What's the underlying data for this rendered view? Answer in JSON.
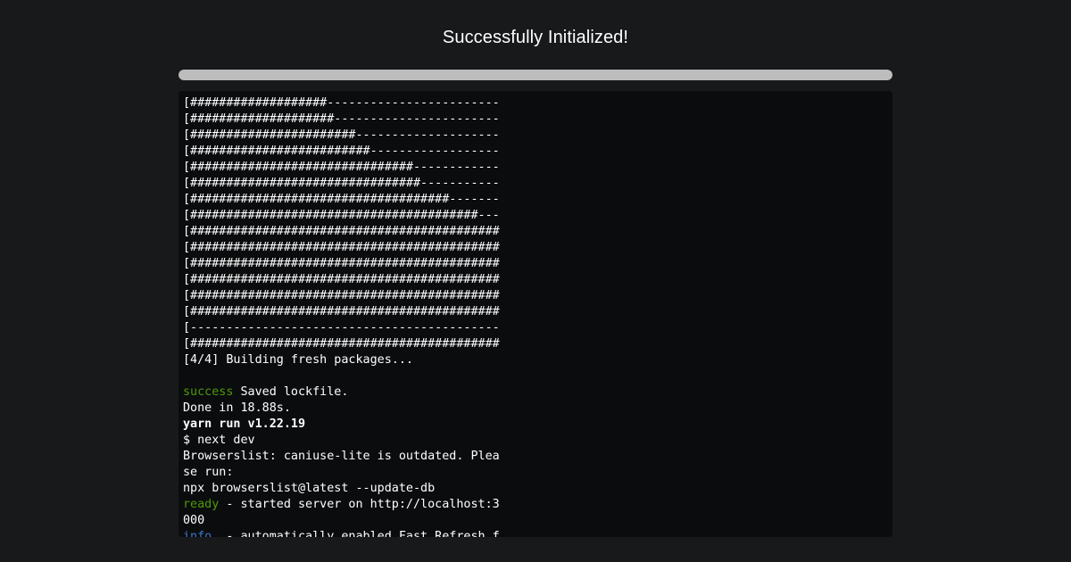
{
  "header": {
    "title": "Successfully Initialized!"
  },
  "progress": {
    "fraction": 1.0
  },
  "colors": {
    "background": "#18191b",
    "terminal_background": "#0b0c0e",
    "progress_fill": "#bdbdbd",
    "success": "#4e9a06",
    "ready": "#4e9a06",
    "info": "#3a78c9",
    "text": "#ffffff"
  },
  "terminal": {
    "lines": [
      {
        "text": "[###################------------------------"
      },
      {
        "text": "[####################-----------------------"
      },
      {
        "text": "[#######################--------------------"
      },
      {
        "text": "[#########################------------------"
      },
      {
        "text": "[###############################------------"
      },
      {
        "text": "[################################-----------"
      },
      {
        "text": "[####################################-------"
      },
      {
        "text": "[########################################---"
      },
      {
        "text": "[###########################################"
      },
      {
        "text": "[###########################################"
      },
      {
        "text": "[###########################################"
      },
      {
        "text": "[###########################################"
      },
      {
        "text": "[###########################################"
      },
      {
        "text": "[###########################################"
      },
      {
        "text": "[-------------------------------------------"
      },
      {
        "text": "[###########################################"
      },
      {
        "text": "[4/4] Building fresh packages..."
      },
      {
        "text": ""
      },
      {
        "tag": "success",
        "tag_color": "#4e9a06",
        "text": " Saved lockfile."
      },
      {
        "text": "Done in 18.88s."
      },
      {
        "text": "yarn run v1.22.19",
        "bold": true
      },
      {
        "text": "$ next dev"
      },
      {
        "text": "Browserslist: caniuse-lite is outdated. Plea"
      },
      {
        "text": "se run:"
      },
      {
        "text": "npx browserslist@latest --update-db"
      },
      {
        "tag": "ready",
        "tag_color": "#4e9a06",
        "text": " - started server on http://localhost:3"
      },
      {
        "text": "000"
      },
      {
        "tag": "info",
        "tag_color": "#3a78c9",
        "text": "  - automatically enabled Fast Refresh f"
      }
    ]
  }
}
